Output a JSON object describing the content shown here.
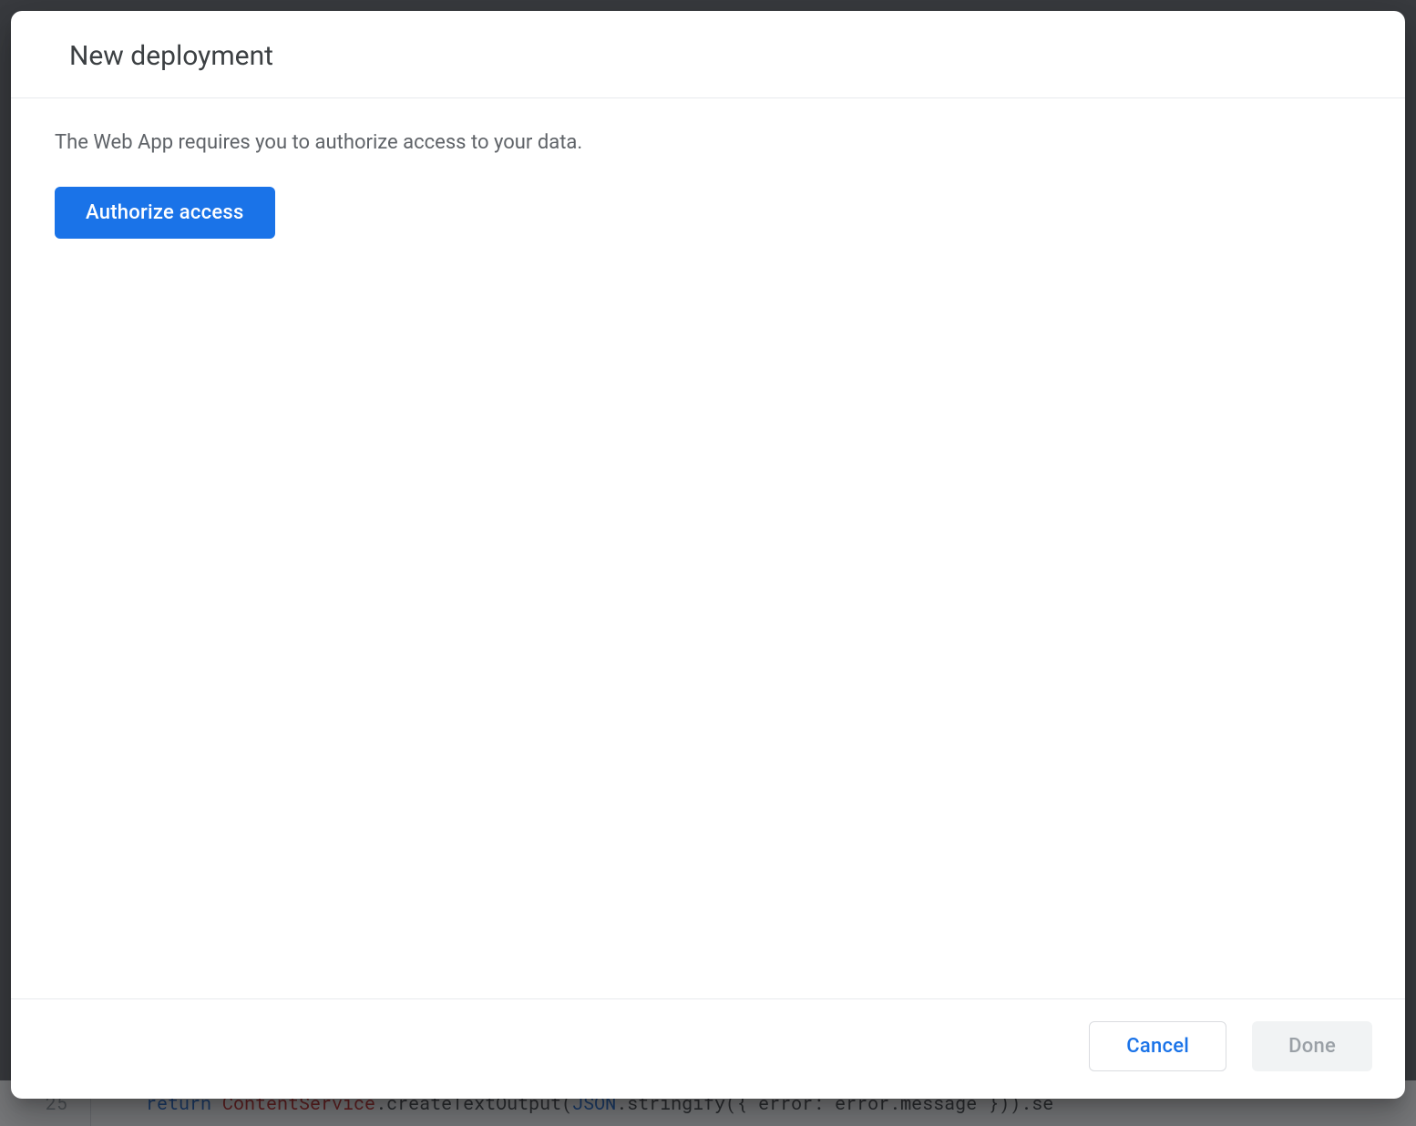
{
  "dialog": {
    "title": "New deployment",
    "body_text": "The Web App requires you to authorize access to your data.",
    "authorize_label": "Authorize access",
    "cancel_label": "Cancel",
    "done_label": "Done"
  },
  "background_code": {
    "line_number": "25",
    "tokens": {
      "return": "return",
      "class": "ContentService",
      "method1": ".createTextOutput(",
      "json": "JSON",
      "method2": ".stringify({ error: error.message })).se"
    }
  }
}
